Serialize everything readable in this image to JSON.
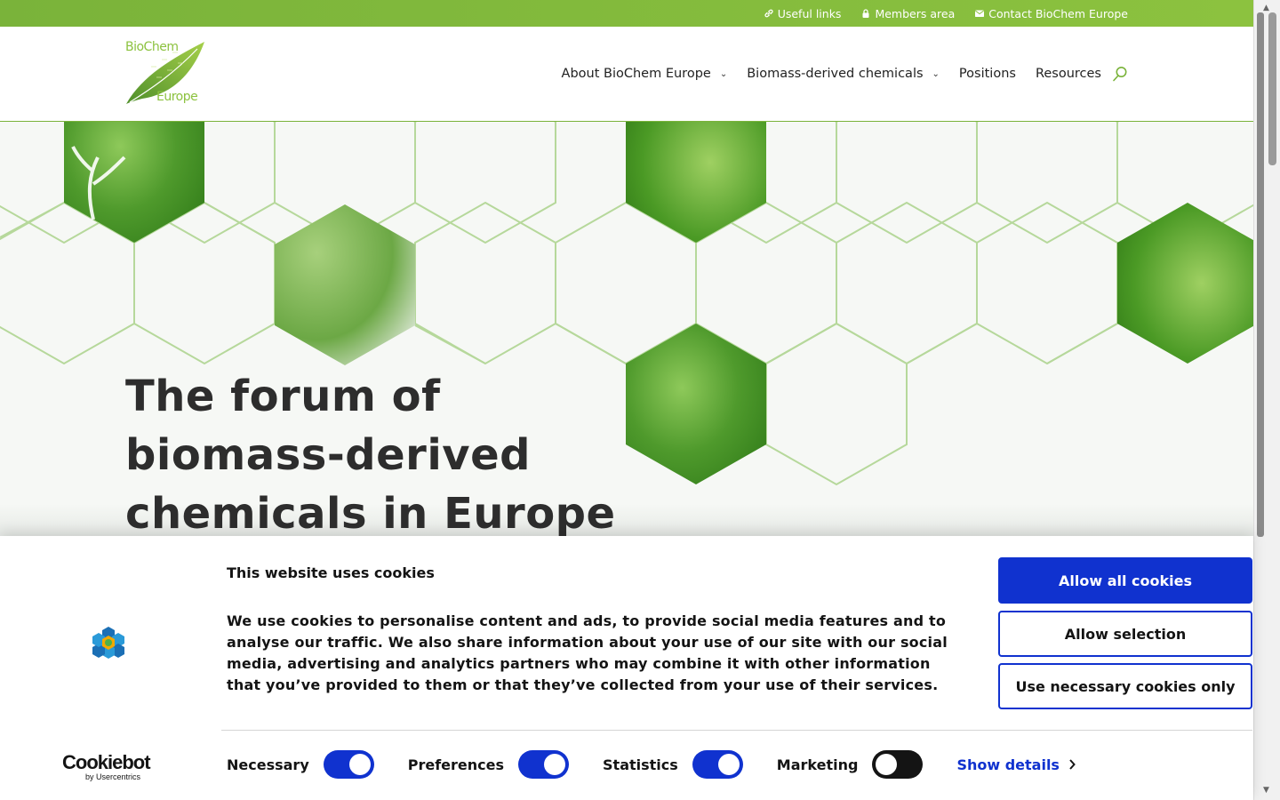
{
  "topbar": {
    "links": [
      {
        "label": "Useful links",
        "icon": "link-icon"
      },
      {
        "label": "Members area",
        "icon": "lock-icon"
      },
      {
        "label": "Contact BioChem Europe",
        "icon": "envelope-icon"
      }
    ]
  },
  "header": {
    "logo_line1": "BioChem",
    "logo_line2": "Europe",
    "nav": [
      {
        "label": "About BioChem Europe",
        "has_dropdown": true
      },
      {
        "label": "Biomass-derived chemicals",
        "has_dropdown": true
      },
      {
        "label": "Positions",
        "has_dropdown": false
      },
      {
        "label": "Resources",
        "has_dropdown": false
      }
    ]
  },
  "hero": {
    "title_lines": [
      "The forum of",
      "biomass-derived",
      "chemicals in Europe"
    ]
  },
  "cookie": {
    "title": "This website uses cookies",
    "text": "We use cookies to personalise content and ads, to provide social media features and to analyse our traffic. We also share information about your use of our site with our social media, advertising and analytics partners who may combine it with other information that you’ve provided to them or that they’ve collected from your use of their services.",
    "buttons": {
      "allow_all": "Allow all cookies",
      "allow_selection": "Allow selection",
      "necessary_only": "Use necessary cookies only"
    },
    "toggles": [
      {
        "label": "Necessary",
        "on": true
      },
      {
        "label": "Preferences",
        "on": true
      },
      {
        "label": "Statistics",
        "on": true
      },
      {
        "label": "Marketing",
        "on": false
      }
    ],
    "show_details": "Show details",
    "brand_main": "Cookiebot",
    "brand_sub": "by Usercentrics"
  },
  "colors": {
    "brand_green": "#8cc23f",
    "cookie_blue": "#1032cf"
  }
}
